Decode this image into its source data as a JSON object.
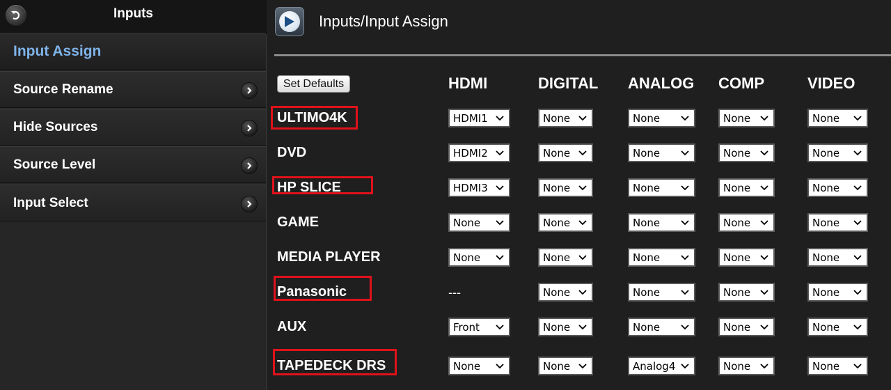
{
  "sidebar": {
    "title": "Inputs",
    "items": [
      {
        "label": "Input Assign",
        "active": true
      },
      {
        "label": "Source Rename"
      },
      {
        "label": "Hide Sources"
      },
      {
        "label": "Source Level"
      },
      {
        "label": "Input Select"
      }
    ]
  },
  "main": {
    "title": "Inputs/Input Assign",
    "set_defaults_label": "Set Defaults",
    "columns": [
      "HDMI",
      "DIGITAL",
      "ANALOG",
      "COMP",
      "VIDEO"
    ],
    "rows": [
      {
        "name": "ULTIMO4K",
        "highlighted": true,
        "values": [
          "HDMI1",
          "None",
          "None",
          "None",
          "None"
        ]
      },
      {
        "name": "DVD",
        "highlighted": false,
        "values": [
          "HDMI2",
          "None",
          "None",
          "None",
          "None"
        ]
      },
      {
        "name": "HP SLICE",
        "highlighted": true,
        "values": [
          "HDMI3",
          "None",
          "None",
          "None",
          "None"
        ]
      },
      {
        "name": "GAME",
        "highlighted": false,
        "values": [
          "None",
          "None",
          "None",
          "None",
          "None"
        ]
      },
      {
        "name": "MEDIA PLAYER",
        "highlighted": false,
        "values": [
          "None",
          "None",
          "None",
          "None",
          "None"
        ]
      },
      {
        "name": "Panasonic",
        "highlighted": true,
        "values": [
          "---",
          "None",
          "None",
          "None",
          "None"
        ]
      },
      {
        "name": "AUX",
        "highlighted": false,
        "values": [
          "Front",
          "None",
          "None",
          "None",
          "None"
        ]
      },
      {
        "name": "TAPEDECK DRS",
        "highlighted": true,
        "values": [
          "None",
          "None",
          "Analog4",
          "None",
          "None"
        ]
      }
    ]
  },
  "colors": {
    "active_nav": "#7fb4ea",
    "highlight_box": "#e0121a",
    "background": "#1f1f1f"
  }
}
